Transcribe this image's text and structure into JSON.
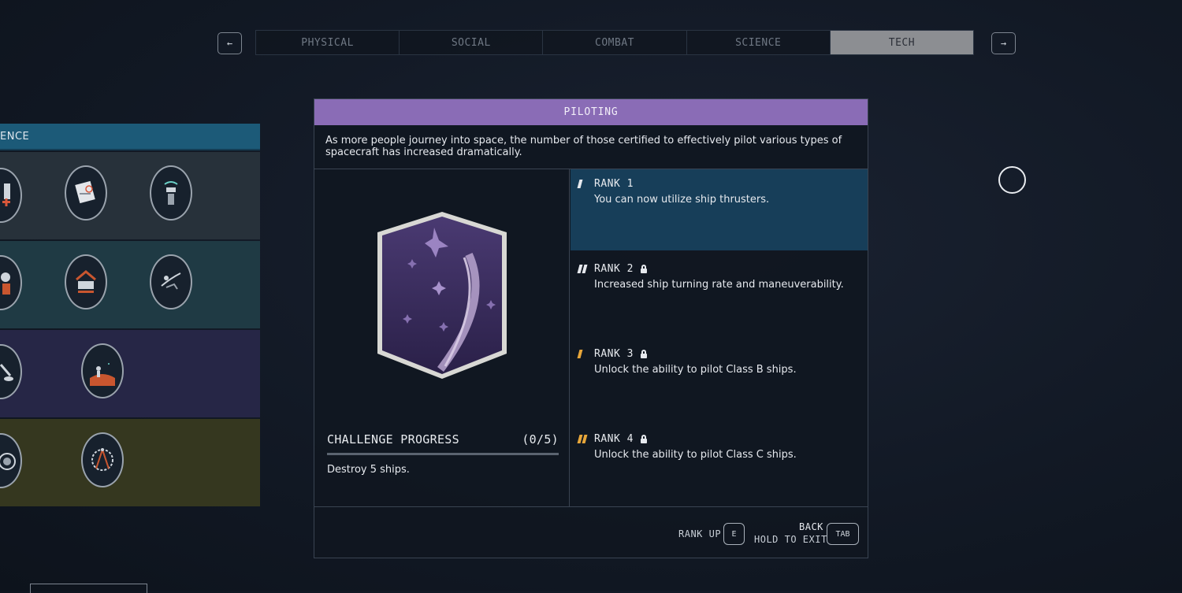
{
  "nav": {
    "prev_arrow": "←",
    "next_arrow": "→",
    "tabs": [
      {
        "label": "PHYSICAL"
      },
      {
        "label": "SOCIAL"
      },
      {
        "label": "COMBAT"
      },
      {
        "label": "SCIENCE"
      },
      {
        "label": "TECH",
        "active": true
      }
    ]
  },
  "tree": {
    "header": "ENCE",
    "rows": [
      {
        "color": "#27313a",
        "icons": [
          "gear-hand-icon",
          "document-icon",
          "scanner-icon"
        ]
      },
      {
        "color": "#1f3a44",
        "icons": [
          "robot-icon",
          "workbench-icon",
          "planet-creature-icon"
        ]
      },
      {
        "color": "#262646",
        "icons": [
          "tool-icon",
          "astronaut-planet-icon"
        ]
      },
      {
        "color": "#35371f",
        "icons": [
          "reactor-icon",
          "compass-gear-icon"
        ]
      }
    ]
  },
  "skill": {
    "title": "PILOTING",
    "title_color": "#8a6cb6",
    "description": "As more people journey into space, the number of those certified to effectively pilot various types of spacecraft has increased dramatically.",
    "badge_icon": "ship-patch-icon",
    "challenge": {
      "label": "CHALLENGE PROGRESS",
      "progress_text": "(0/5)",
      "progress": 0,
      "description": "Destroy 5 ships."
    },
    "ranks": [
      {
        "label": "RANK 1",
        "description": "You can now utilize ship thrusters.",
        "locked": false,
        "active": true
      },
      {
        "label": "RANK 2",
        "description": "Increased ship turning rate and maneuverability.",
        "locked": true,
        "active": false
      },
      {
        "label": "RANK 3",
        "description": "Unlock the ability to pilot Class B ships.",
        "locked": true,
        "active": false
      },
      {
        "label": "RANK 4",
        "description": "Unlock the ability to pilot Class C ships.",
        "locked": true,
        "active": false
      }
    ]
  },
  "footer": {
    "rank_up_label": "RANK UP",
    "rank_up_key": "E",
    "back_label": "BACK",
    "hold_exit_label": "HOLD TO EXIT",
    "back_key": "TAB"
  }
}
